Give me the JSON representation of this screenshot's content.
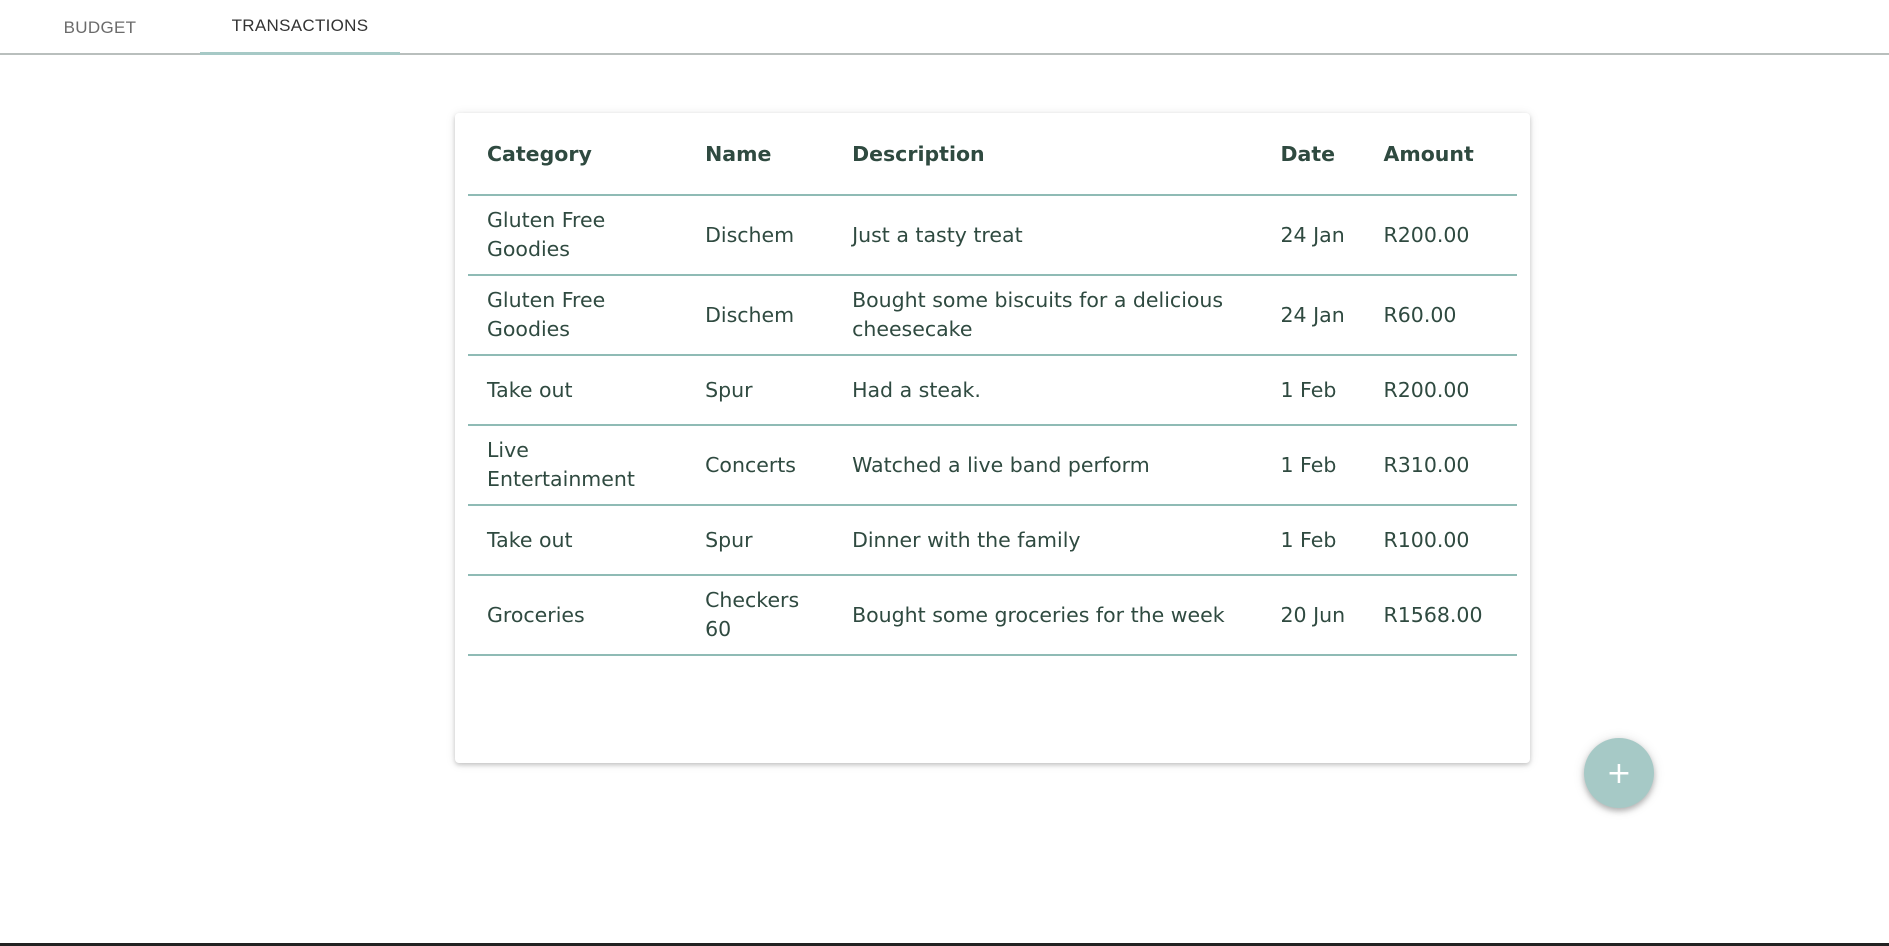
{
  "tabs": [
    {
      "label": "BUDGET",
      "active": false
    },
    {
      "label": "TRANSACTIONS",
      "active": true
    }
  ],
  "table": {
    "headers": [
      "Category",
      "Name",
      "Description",
      "Date",
      "Amount"
    ],
    "rows": [
      {
        "category": "Gluten Free Goodies",
        "name": "Dischem",
        "description": "Just a tasty treat",
        "date": "24 Jan",
        "amount": "R200.00"
      },
      {
        "category": "Gluten Free Goodies",
        "name": "Dischem",
        "description": "Bought some biscuits for a delicious cheesecake",
        "date": "24 Jan",
        "amount": "R60.00"
      },
      {
        "category": "Take out",
        "name": "Spur",
        "description": "Had a steak.",
        "date": "1 Feb",
        "amount": "R200.00"
      },
      {
        "category": "Live Entertainment",
        "name": "Concerts",
        "description": "Watched a live band perform",
        "date": "1 Feb",
        "amount": "R310.00"
      },
      {
        "category": "Take out",
        "name": "Spur",
        "description": "Dinner with the family",
        "date": "1 Feb",
        "amount": "R100.00"
      },
      {
        "category": "Groceries",
        "name": "Checkers 60",
        "description": "Bought some groceries for the week",
        "date": "20 Jun",
        "amount": "R1568.00"
      }
    ]
  },
  "fab": {
    "icon": "plus-icon",
    "glyph": "+"
  },
  "colors": {
    "accent": "#a6c9c6",
    "text": "#2f4a40",
    "divider": "#8fbbb5"
  }
}
